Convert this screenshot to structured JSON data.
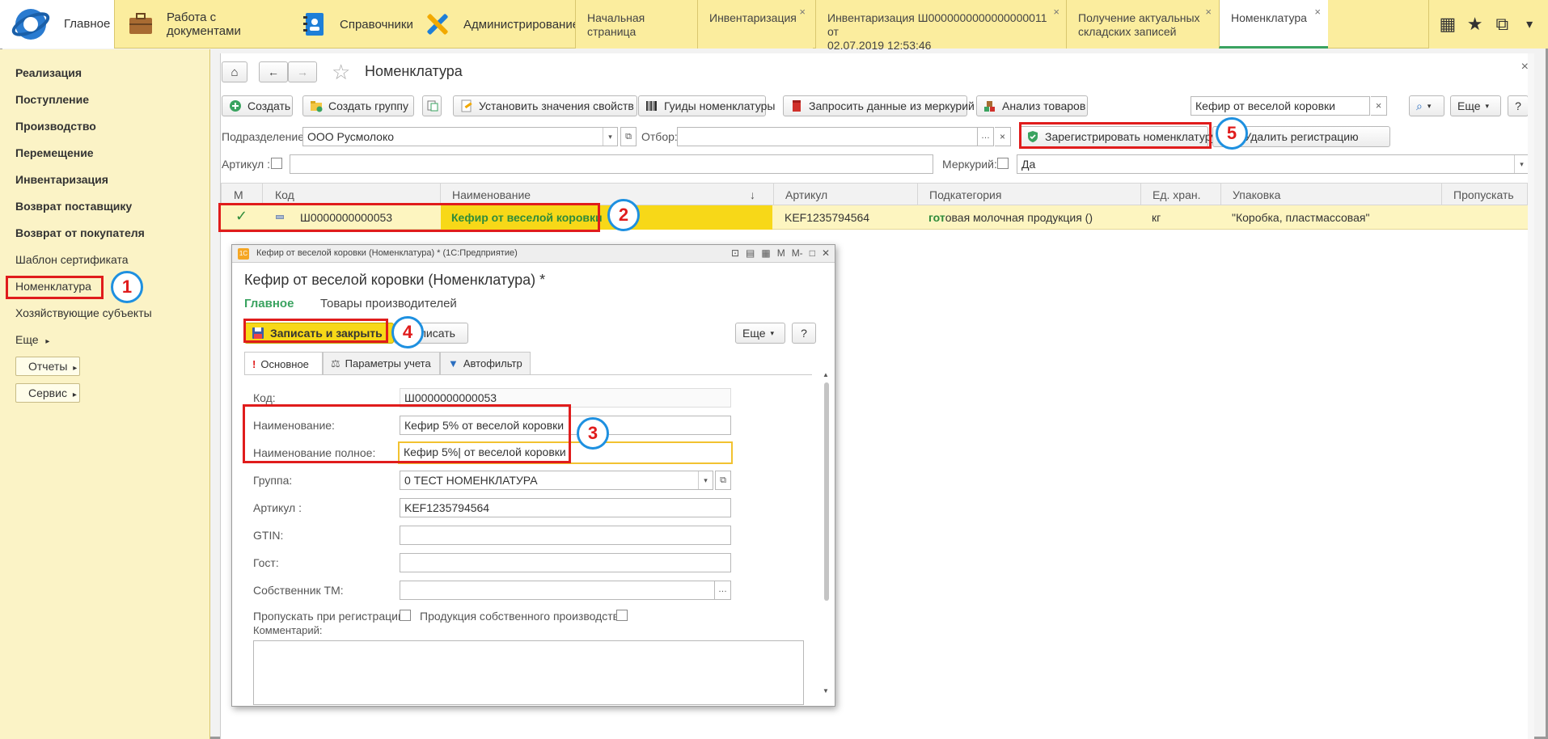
{
  "topbar": {
    "home_label": "Главное",
    "sections": [
      {
        "label": "Работа с документами",
        "icon": "briefcase-icon"
      },
      {
        "label": "Справочники",
        "icon": "address-book-icon"
      },
      {
        "label": "Администрирование",
        "icon": "tools-icon"
      }
    ],
    "tabs": [
      {
        "line1": "Начальная страница",
        "line2": ""
      },
      {
        "line1": "Инвентаризация",
        "line2": ""
      },
      {
        "line1": "Инвентаризация Ш0000000000000000011 от",
        "line2": "02.07.2019 12:53:46"
      },
      {
        "line1": "Получение актуальных",
        "line2": "складских записей"
      },
      {
        "line1": "Номенклатура",
        "line2": ""
      }
    ]
  },
  "sidebar": {
    "items": [
      "Реализация",
      "Поступление",
      "Производство",
      "Перемещение",
      "Инвентаризация",
      "Возврат поставщику",
      "Возврат от покупателя",
      "Шаблон сертификата",
      "Номенклатура",
      "Хозяйствующие субъекты",
      "Еще"
    ],
    "reports_label": "Отчеты",
    "service_label": "Сервис"
  },
  "page": {
    "title": "Номенклатура",
    "close_glyph": "×"
  },
  "toolbar": {
    "create": "Создать",
    "create_group": "Создать группу",
    "set_props": "Установить значения свойств",
    "guids": "Гуиды номенклатуры",
    "request_mercury": "Запросить данные из меркурий",
    "analysis": "Анализ товаров",
    "search_value": "Кефир от веселой коровки",
    "more": "Еще",
    "help": "?"
  },
  "filters": {
    "division_label": "Подразделение:",
    "division_value": "ООО Русмолоко",
    "selection_label": "Отбор:",
    "selection_value": "",
    "register": "Зарегистрировать номенклатуру",
    "unregister": "Удалить регистрацию",
    "article_label": "Артикул :",
    "mercury_label": "Меркурий:",
    "mercury_value": "Да"
  },
  "table": {
    "headers": [
      "М",
      "Код",
      "Наименование",
      "Артикул",
      "Подкатегория",
      "Ед. хран.",
      "Упаковка",
      "Пропускать"
    ],
    "sort_glyph": "↓",
    "row": {
      "check": "✓",
      "code": "Ш0000000000053",
      "name": "Кефир от веселой коровки",
      "article": "KEF1235794564",
      "subcategory_bold": "гот",
      "subcategory_rest": "овая молочная продукция ()",
      "unit": "кг",
      "package": "\"Коробка, пластмассовая\""
    }
  },
  "modal": {
    "window_title": "Кефир от веселой коровки (Номенклатура) * (1С:Предприятие)",
    "heading": "Кефир от веселой коровки (Номенклатура) *",
    "nav_main": "Главное",
    "nav_producers": "Товары производителей",
    "save_close": "Записать и закрыть",
    "save": "Записать",
    "more": "Еще",
    "help": "?",
    "tabs": [
      "Основное",
      "Параметры учета",
      "Автофильтр"
    ],
    "fields": {
      "code_label": "Код:",
      "code_value": "Ш0000000000053",
      "name_label": "Наименование:",
      "name_value": "Кефир 5% от веселой коровки",
      "fullname_label": "Наименование полное:",
      "fullname_value": "Кефир 5%| от веселой коровки",
      "group_label": "Группа:",
      "group_value": "0 ТЕСТ НОМЕНКЛАТУРА",
      "article_label": "Артикул :",
      "article_value": "KEF1235794564",
      "gtin_label": "GTIN:",
      "gost_label": "Гост:",
      "owner_label": "Собственник ТМ:",
      "skip_label": "Пропускать при регистрации:",
      "own_prod_label": "Продукция собственного производства:",
      "comment_label": "Комментарий:"
    }
  },
  "annotations": [
    "1",
    "2",
    "3",
    "4",
    "5"
  ],
  "colors": {
    "accent_green": "#3aa360",
    "highlight_yellow": "#f7d818",
    "annotation_red": "#e01c1c",
    "annotation_blue": "#1e90e0"
  }
}
